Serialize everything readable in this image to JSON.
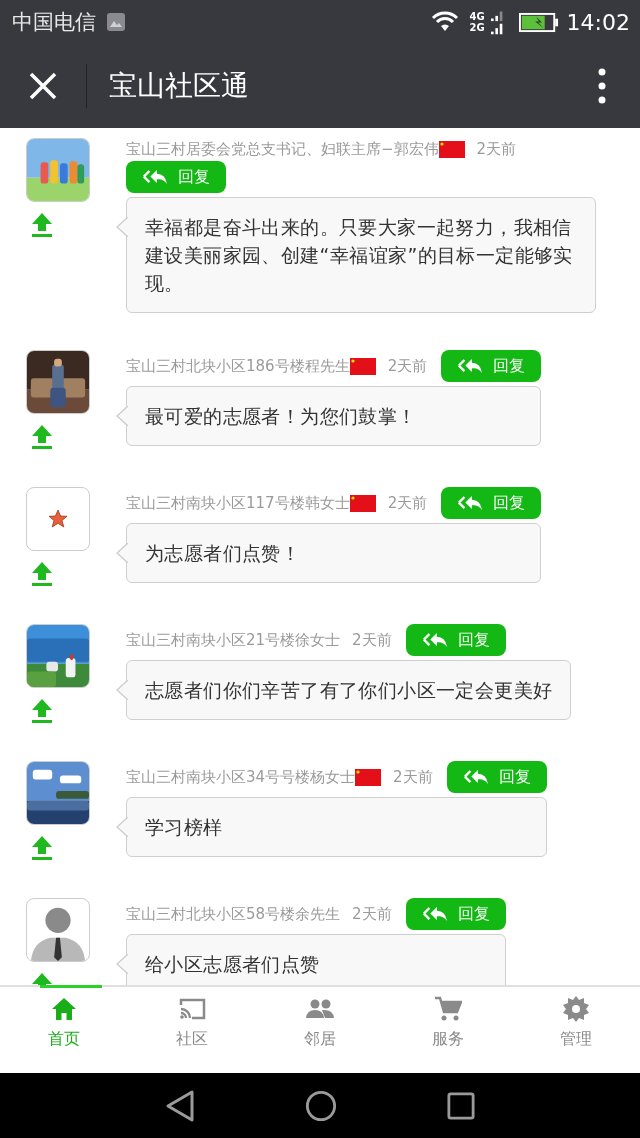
{
  "status_bar": {
    "carrier": "中国电信",
    "network_top": "4G",
    "network_bottom": "2G",
    "time": "14:02"
  },
  "header": {
    "title": "宝山社区通"
  },
  "comments": [
    {
      "kind": "stacked",
      "author": "宝山三村居委会党总支书记、妇联主席−郭宏伟",
      "flag": true,
      "time": "2天前",
      "reply": "回复",
      "text": "幸福都是奋斗出来的。只要大家一起努力，我相信建设美丽家园、创建“幸福谊家”的目标一定能够实现。"
    },
    {
      "kind": "inline",
      "author": "宝山三村北块小区186号楼程先生",
      "flag": true,
      "time": "2天前",
      "reply": "回复",
      "text": "最可爱的志愿者！为您们鼓掌！"
    },
    {
      "kind": "inline",
      "avatar": {
        "kind": "star"
      },
      "author": "宝山三村南块小区117号楼韩女士",
      "flag": true,
      "time": "2天前",
      "reply": "回复",
      "text": "为志愿者们点赞！"
    },
    {
      "kind": "inline",
      "author": "宝山三村南块小区21号楼徐女士",
      "flag": false,
      "time": "2天前",
      "reply": "回复",
      "text": "志愿者们你们辛苦了有了你们小区一定会更美好"
    },
    {
      "kind": "inline",
      "author": "宝山三村南块小区34号号楼杨女士",
      "flag": true,
      "time": "2天前",
      "reply": "回复",
      "text": "学习榜样"
    },
    {
      "kind": "inline",
      "avatar": {
        "kind": "silhouette"
      },
      "author": "宝山三村北块小区58号楼余先生",
      "flag": false,
      "time": "2天前",
      "reply": "回复",
      "text": "给小区志愿者们点赞"
    }
  ],
  "tab_bar": [
    {
      "label": "首页",
      "selected": true
    },
    {
      "label": "社区",
      "selected": false
    },
    {
      "label": "邻居",
      "selected": false
    },
    {
      "label": "服务",
      "selected": false
    },
    {
      "label": "管理",
      "selected": false
    }
  ]
}
